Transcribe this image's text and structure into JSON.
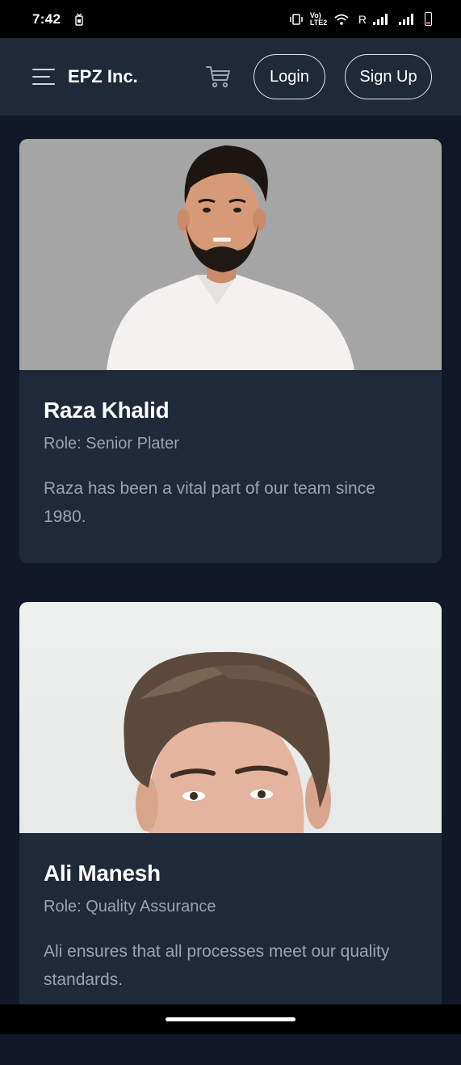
{
  "status_bar": {
    "time": "7:42",
    "network_label": "Vo) LTE2",
    "carrier_indicator": "R"
  },
  "navbar": {
    "brand": "EPZ Inc.",
    "login_label": "Login",
    "signup_label": "Sign Up"
  },
  "team": [
    {
      "name": "Raza Khalid",
      "role": "Role: Senior Plater",
      "description": "Raza has been a vital part of our team since 1980."
    },
    {
      "name": "Ali Manesh",
      "role": "Role: Quality Assurance",
      "description": "Ali ensures that all processes meet our quality standards."
    }
  ],
  "icons": {
    "menu": "hamburger-icon",
    "cart": "cart-icon"
  },
  "colors": {
    "page_bg": "#111827",
    "navbar_bg": "#1f2937",
    "card_bg": "#1f2937",
    "muted_text": "#9ca3af"
  }
}
